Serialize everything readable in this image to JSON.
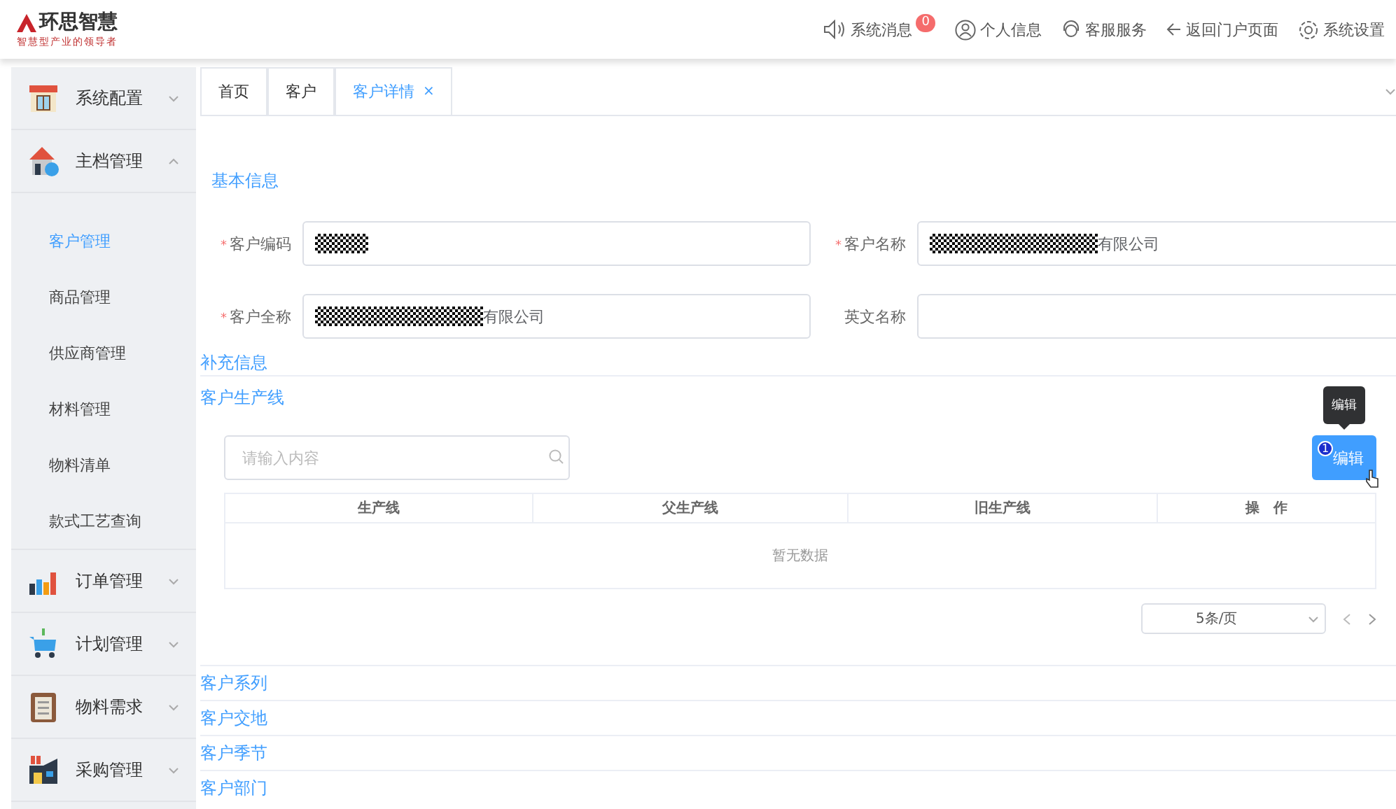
{
  "header": {
    "logo": "环思智慧",
    "tagline": "智慧型产业的领导者",
    "actions": [
      {
        "label": "系统消息",
        "badge": "0"
      },
      {
        "label": "个人信息"
      },
      {
        "label": "客服服务"
      },
      {
        "label": "返回门户页面"
      },
      {
        "label": "系统设置"
      }
    ]
  },
  "sidebar": {
    "groups": [
      {
        "label": "系统配置",
        "expanded": false
      },
      {
        "label": "主档管理",
        "expanded": true,
        "children": [
          {
            "label": "客户管理",
            "selected": true
          },
          {
            "label": "商品管理",
            "selected": false
          },
          {
            "label": "供应商管理",
            "selected": false
          },
          {
            "label": "材料管理",
            "selected": false
          },
          {
            "label": "物料清单",
            "selected": false
          },
          {
            "label": "款式工艺查询",
            "selected": false
          }
        ]
      },
      {
        "label": "订单管理",
        "expanded": false
      },
      {
        "label": "计划管理",
        "expanded": false
      },
      {
        "label": "物料需求",
        "expanded": false
      },
      {
        "label": "采购管理",
        "expanded": false
      }
    ]
  },
  "tabs": [
    {
      "label": "首页",
      "selected": false
    },
    {
      "label": "客户",
      "selected": false
    },
    {
      "label": "客户详情",
      "selected": true,
      "close": "×"
    }
  ],
  "basic_info": {
    "title": "基本信息",
    "fields": [
      {
        "label": "客户编码",
        "required_mark": "*",
        "masked": true
      },
      {
        "label": "客户名称",
        "required_mark": "*",
        "masked": true,
        "value": "有限公司"
      },
      {
        "label": "客户全称",
        "required_mark": "*",
        "masked": true,
        "value": "有限公司"
      },
      {
        "label": "英文名称"
      }
    ]
  },
  "extra_info": {
    "title": "补充信息"
  },
  "production_line": {
    "title": "客户生产线",
    "search": {
      "placeholder": "请输入内容"
    },
    "edit_button": {
      "label": "编辑",
      "badge": "1",
      "tooltip": "编辑"
    },
    "table": {
      "columns": [
        "生产线",
        "父生产线",
        "旧生产线",
        "操　作"
      ],
      "empty": "暂无数据"
    },
    "pager": {
      "page_size": "5条/页"
    }
  },
  "sections": [
    "客户系列",
    "客户交地",
    "客户季节",
    "客户部门"
  ]
}
